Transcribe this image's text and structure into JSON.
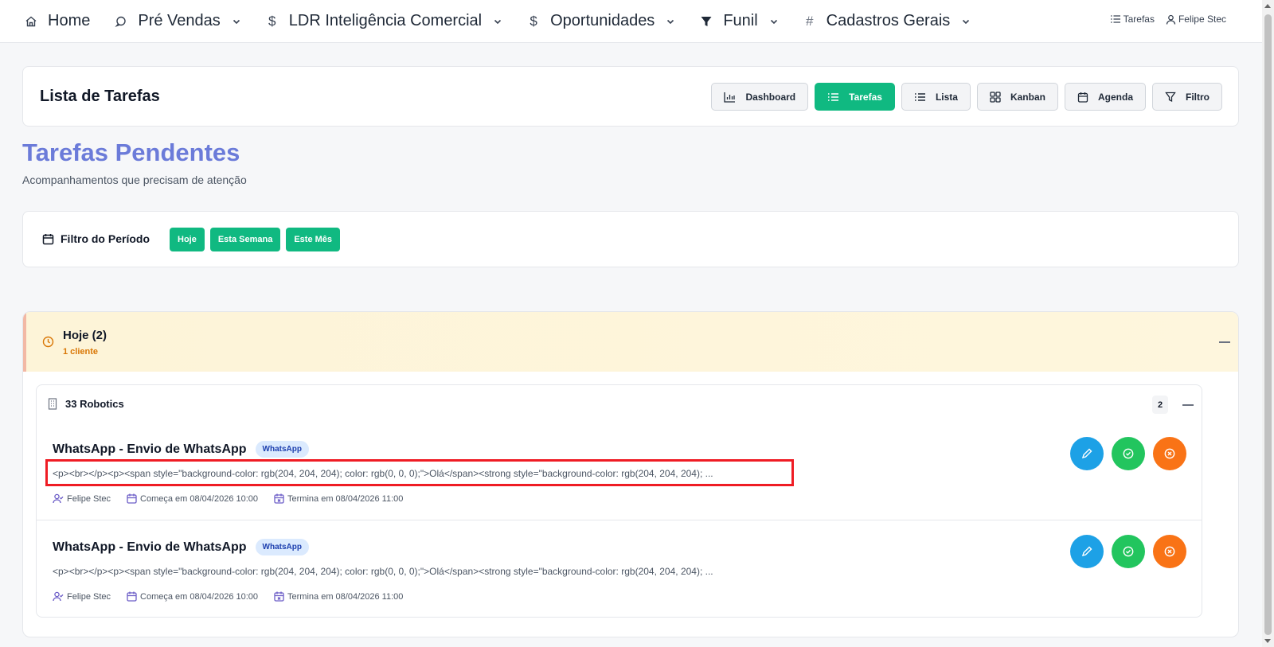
{
  "nav": {
    "items": [
      {
        "label": "Home",
        "icon": "home-icon"
      },
      {
        "label": "Pré Vendas",
        "icon": "chat-icon"
      },
      {
        "label": "LDR Inteligência Comercial",
        "icon": "dollar-icon"
      },
      {
        "label": "Oportunidades",
        "icon": "dollar-icon"
      },
      {
        "label": "Funil",
        "icon": "funnel-icon"
      },
      {
        "label": "Cadastros Gerais",
        "icon": "hash-icon"
      }
    ],
    "right": {
      "tasks": "Tarefas",
      "user": "Felipe Stec"
    }
  },
  "header": {
    "title": "Lista de Tarefas",
    "views": [
      "Dashboard",
      "Tarefas",
      "Lista",
      "Kanban",
      "Agenda",
      "Filtro"
    ],
    "active_view": "Tarefas"
  },
  "page": {
    "title": "Tarefas Pendentes",
    "subtitle": "Acompanhamentos que precisam de atenção"
  },
  "period": {
    "label": "Filtro do Período",
    "options": [
      "Hoje",
      "Esta Semana",
      "Este Mês"
    ]
  },
  "today": {
    "title": "Hoje (2)",
    "subtitle": "1 cliente",
    "client": {
      "name": "33 Robotics",
      "count": "2",
      "tasks": [
        {
          "title": "WhatsApp - Envio de WhatsApp",
          "badge": "WhatsApp",
          "description": "<p><br></p><p><span style=\"background-color: rgb(204, 204, 204); color: rgb(0, 0, 0);\">Olá</span><strong style=\"background-color: rgb(204, 204, 204); ...",
          "owner": "Felipe Stec",
          "start": "Começa em 08/04/2026 10:00",
          "end": "Termina em 08/04/2026 11:00"
        },
        {
          "title": "WhatsApp - Envio de WhatsApp",
          "badge": "WhatsApp",
          "description": "<p><br></p><p><span style=\"background-color: rgb(204, 204, 204); color: rgb(0, 0, 0);\">Olá</span><strong style=\"background-color: rgb(204, 204, 204); ...",
          "owner": "Felipe Stec",
          "start": "Começa em 08/04/2026 10:00",
          "end": "Termina em 08/04/2026 11:00"
        }
      ]
    }
  },
  "colors": {
    "accent": "#10b981",
    "title_blue": "#6b7bd9",
    "edit": "#1da1e6",
    "done": "#22c55e",
    "cancel": "#f97316",
    "highlight": "#ef1c24"
  }
}
